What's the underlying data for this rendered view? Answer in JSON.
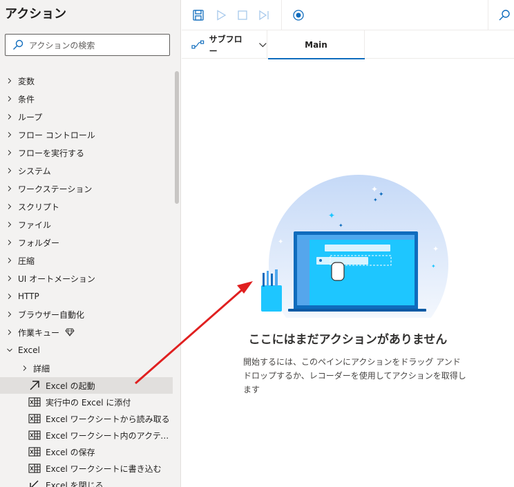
{
  "panel": {
    "title": "アクション",
    "search_placeholder": "アクションの検索",
    "categories": [
      {
        "label": "変数",
        "icon": "chevron-right-icon"
      },
      {
        "label": "条件",
        "icon": "chevron-right-icon"
      },
      {
        "label": "ループ",
        "icon": "chevron-right-icon"
      },
      {
        "label": "フロー コントロール",
        "icon": "chevron-right-icon"
      },
      {
        "label": "フローを実行する",
        "icon": "chevron-right-icon"
      },
      {
        "label": "システム",
        "icon": "chevron-right-icon"
      },
      {
        "label": "ワークステーション",
        "icon": "chevron-right-icon"
      },
      {
        "label": "スクリプト",
        "icon": "chevron-right-icon"
      },
      {
        "label": "ファイル",
        "icon": "chevron-right-icon"
      },
      {
        "label": "フォルダー",
        "icon": "chevron-right-icon"
      },
      {
        "label": "圧縮",
        "icon": "chevron-right-icon"
      },
      {
        "label": "UI オートメーション",
        "icon": "chevron-right-icon"
      },
      {
        "label": "HTTP",
        "icon": "chevron-right-icon"
      },
      {
        "label": "ブラウザー自動化",
        "icon": "chevron-right-icon"
      },
      {
        "label": "作業キュー",
        "icon": "chevron-right-icon",
        "badge_icon": "premium-diamond-icon"
      },
      {
        "label": "Excel",
        "icon": "chevron-down-icon"
      }
    ],
    "excel_sub": {
      "label": "詳細"
    },
    "excel_actions": [
      {
        "label": "Excel の起動",
        "icon": "launch-arrow-icon"
      },
      {
        "label": "実行中の Excel に添付",
        "icon": "excel-grid-icon"
      },
      {
        "label": "Excel ワークシートから読み取る",
        "icon": "excel-grid-icon"
      },
      {
        "label": "Excel ワークシート内のアクティブなセ...",
        "icon": "excel-grid-icon"
      },
      {
        "label": "Excel の保存",
        "icon": "excel-grid-icon"
      },
      {
        "label": "Excel ワークシートに書き込む",
        "icon": "excel-grid-icon"
      },
      {
        "label": "Excel を閉じる",
        "icon": "close-arrow-icon"
      }
    ]
  },
  "toolbar": {
    "buttons": [
      "save-icon",
      "run-icon",
      "stop-icon",
      "step-icon",
      "record-icon",
      "search-icon"
    ]
  },
  "tabs": {
    "subflow_label": "サブフロー",
    "main_label": "Main"
  },
  "canvas": {
    "empty_title": "ここにはまだアクションがありません",
    "empty_desc": "開始するには、このペインにアクションをドラッグ アンド ドロップするか、レコーダーを使用してアクションを取得します"
  },
  "colors": {
    "accent": "#0f6cbd",
    "annotation_arrow": "#e02020",
    "highlight": "#e1dfdd"
  }
}
